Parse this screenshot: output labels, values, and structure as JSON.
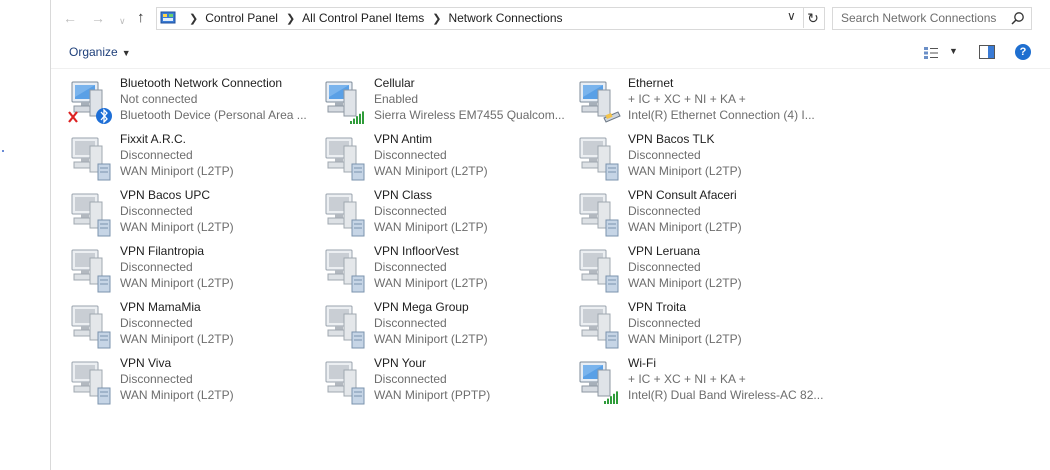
{
  "window": {
    "breadcrumb": [
      "Control Panel",
      "All Control Panel Items",
      "Network Connections"
    ],
    "search_placeholder": "Search Network Connections"
  },
  "commandbar": {
    "organize_label": "Organize"
  },
  "connections": [
    {
      "name": "Bluetooth Network Connection",
      "status": "Not connected",
      "device": "Bluetooth Device (Personal Area ...",
      "type": "bluetooth"
    },
    {
      "name": "Cellular",
      "status": "Enabled",
      "device": "Sierra Wireless EM7455 Qualcom...",
      "type": "cellular"
    },
    {
      "name": "Ethernet",
      "status": "+ IC + XC + NI + KA +",
      "device": "Intel(R) Ethernet Connection (4) I...",
      "type": "ethernet"
    },
    {
      "name": "Fixxit A.R.C.",
      "status": "Disconnected",
      "device": "WAN Miniport (L2TP)",
      "type": "vpn"
    },
    {
      "name": "VPN Antim",
      "status": "Disconnected",
      "device": "WAN Miniport (L2TP)",
      "type": "vpn"
    },
    {
      "name": "VPN Bacos TLK",
      "status": "Disconnected",
      "device": "WAN Miniport (L2TP)",
      "type": "vpn"
    },
    {
      "name": "VPN Bacos UPC",
      "status": "Disconnected",
      "device": "WAN Miniport (L2TP)",
      "type": "vpn"
    },
    {
      "name": "VPN Class",
      "status": "Disconnected",
      "device": "WAN Miniport (L2TP)",
      "type": "vpn"
    },
    {
      "name": "VPN Consult Afaceri",
      "status": "Disconnected",
      "device": "WAN Miniport (L2TP)",
      "type": "vpn"
    },
    {
      "name": "VPN Filantropia",
      "status": "Disconnected",
      "device": "WAN Miniport (L2TP)",
      "type": "vpn"
    },
    {
      "name": "VPN InfloorVest",
      "status": "Disconnected",
      "device": "WAN Miniport (L2TP)",
      "type": "vpn"
    },
    {
      "name": "VPN Leruana",
      "status": "Disconnected",
      "device": "WAN Miniport (L2TP)",
      "type": "vpn"
    },
    {
      "name": "VPN MamaMia",
      "status": "Disconnected",
      "device": "WAN Miniport (L2TP)",
      "type": "vpn"
    },
    {
      "name": "VPN Mega Group",
      "status": "Disconnected",
      "device": "WAN Miniport (L2TP)",
      "type": "vpn"
    },
    {
      "name": "VPN Troita",
      "status": "Disconnected",
      "device": "WAN Miniport (L2TP)",
      "type": "vpn"
    },
    {
      "name": "VPN Viva",
      "status": "Disconnected",
      "device": "WAN Miniport (L2TP)",
      "type": "vpn"
    },
    {
      "name": "VPN Your",
      "status": "Disconnected",
      "device": "WAN Miniport (PPTP)",
      "type": "vpn"
    },
    {
      "name": "Wi-Fi",
      "status": "+ IC + XC + NI + KA +",
      "device": "Intel(R) Dual Band Wireless-AC 82...",
      "type": "wifi"
    }
  ]
}
